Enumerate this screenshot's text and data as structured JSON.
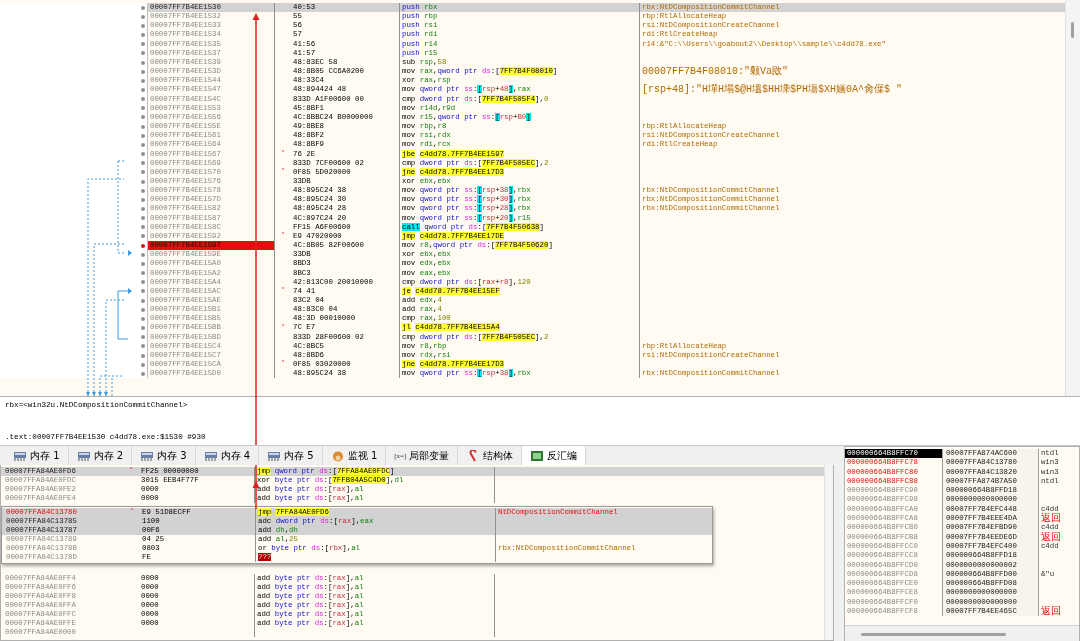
{
  "disassembly": {
    "rows": [
      {
        "address": "00007FF7B4EE1530",
        "bytes": "40:53",
        "mnemonic": "push",
        "operands": "rbx",
        "comment": "rbx:NtDCompositionCommitChannel",
        "kind": "stack",
        "selected": true,
        "breakpoint": false
      },
      {
        "address": "00007FF7B4EE1532",
        "bytes": "55",
        "mnemonic": "push",
        "operands": "rbp",
        "comment": "rbp:RtlAllocateHeap",
        "kind": "stack",
        "selected": false,
        "breakpoint": false
      },
      {
        "address": "00007FF7B4EE1533",
        "bytes": "56",
        "mnemonic": "push",
        "operands": "rsi",
        "comment": "rsi:NtDCompositionCreateChannel",
        "kind": "stack",
        "selected": false,
        "breakpoint": false
      },
      {
        "address": "00007FF7B4EE1534",
        "bytes": "57",
        "mnemonic": "push",
        "operands": "rdi",
        "comment": "rdi:RtlCreateHeap",
        "kind": "stack",
        "selected": false,
        "breakpoint": false
      },
      {
        "address": "00007FF7B4EE1535",
        "bytes": "41:56",
        "mnemonic": "push",
        "operands": "r14",
        "comment": "r14:&\"C:\\\\Users\\\\goabout2\\\\Desktop\\\\sample\\\\c4dd78.exe\"",
        "kind": "stack",
        "selected": false,
        "breakpoint": false
      },
      {
        "address": "00007FF7B4EE1537",
        "bytes": "41:57",
        "mnemonic": "push",
        "operands": "r15",
        "kind": "stack",
        "selected": false,
        "breakpoint": false
      },
      {
        "address": "00007FF7B4EE1539",
        "bytes": "48:83EC 58",
        "mnemonic": "sub",
        "operands": "rsp,58",
        "kind": "plain",
        "selected": false,
        "breakpoint": false
      },
      {
        "address": "00007FF7B4EE153D",
        "bytes": "48:8B05 CC6A0200",
        "mnemonic": "mov",
        "operands": "rax,qword ptr ds:[7FF7B4F08010]",
        "comment": "00007FF7B4F08010:\"颡Va敃\"",
        "kind": "plain",
        "selected": false,
        "breakpoint": false
      },
      {
        "address": "00007FF7B4EE1544",
        "bytes": "48:33C4",
        "mnemonic": "xor",
        "operands": "rax,rsp",
        "kind": "plain",
        "selected": false,
        "breakpoint": false
      },
      {
        "address": "00007FF7B4EE1547",
        "bytes": "48:894424 48",
        "mnemonic": "mov",
        "operands": "qword ptr ss:[rsp+48],rax",
        "comment": "[rsp+48]:\"H墠H塌$@H塭$HH塖$PH塲$XH婳0A^肏僷$ \"",
        "kind": "plain",
        "selected": false,
        "breakpoint": false
      },
      {
        "address": "00007FF7B4EE154C",
        "bytes": "833D A1F00600 00",
        "mnemonic": "cmp",
        "operands": "dword ptr ds:[7FF7B4F505F4],0",
        "kind": "plain",
        "selected": false,
        "breakpoint": false
      },
      {
        "address": "00007FF7B4EE1553",
        "bytes": "45:8BF1",
        "mnemonic": "mov",
        "operands": "r14d,r9d",
        "kind": "plain",
        "selected": false,
        "breakpoint": false
      },
      {
        "address": "00007FF7B4EE1556",
        "bytes": "4C:8BBC24 B0000000",
        "mnemonic": "mov",
        "operands": "r15,qword ptr ss:[rsp+B0]",
        "kind": "plain",
        "selected": false,
        "breakpoint": false
      },
      {
        "address": "00007FF7B4EE155E",
        "bytes": "49:8BE8",
        "mnemonic": "mov",
        "operands": "rbp,r8",
        "comment": "rbp:RtlAllocateHeap",
        "kind": "plain",
        "selected": false,
        "breakpoint": false
      },
      {
        "address": "00007FF7B4EE1561",
        "bytes": "48:8BF2",
        "mnemonic": "mov",
        "operands": "rsi,rdx",
        "comment": "rsi:NtDCompositionCreateChannel",
        "kind": "plain",
        "selected": false,
        "breakpoint": false
      },
      {
        "address": "00007FF7B4EE1564",
        "bytes": "48:8BF9",
        "mnemonic": "mov",
        "operands": "rdi,rcx",
        "comment": "rdi:RtlCreateHeap",
        "kind": "plain",
        "selected": false,
        "breakpoint": false
      },
      {
        "address": "00007FF7B4EE1567",
        "bytes": "76 2E",
        "mnemonic": "jbe",
        "operands": "c4dd78.7FF7B4EE1597",
        "kind": "jump",
        "branch": "˅",
        "selected": false,
        "breakpoint": false
      },
      {
        "address": "00007FF7B4EE1569",
        "bytes": "833D 7CF00600 02",
        "mnemonic": "cmp",
        "operands": "dword ptr ds:[7FF7B4F505EC],2",
        "kind": "plain",
        "selected": false,
        "breakpoint": false
      },
      {
        "address": "00007FF7B4EE1570",
        "bytes": "0F85 5D020000",
        "mnemonic": "jne",
        "operands": "c4dd78.7FF7B4EE17D3",
        "kind": "jump",
        "branch": "˅",
        "selected": false,
        "breakpoint": false
      },
      {
        "address": "00007FF7B4EE1576",
        "bytes": "33DB",
        "mnemonic": "xor",
        "operands": "ebx,ebx",
        "kind": "plain",
        "selected": false,
        "breakpoint": false
      },
      {
        "address": "00007FF7B4EE1578",
        "bytes": "48:895C24 38",
        "mnemonic": "mov",
        "operands": "qword ptr ss:[rsp+38],rbx",
        "comment": "rbx:NtDCompositionCommitChannel",
        "kind": "plain",
        "selected": false,
        "breakpoint": false
      },
      {
        "address": "00007FF7B4EE157D",
        "bytes": "48:895C24 30",
        "mnemonic": "mov",
        "operands": "qword ptr ss:[rsp+30],rbx",
        "comment": "rbx:NtDCompositionCommitChannel",
        "kind": "plain",
        "selected": false,
        "breakpoint": false
      },
      {
        "address": "00007FF7B4EE1582",
        "bytes": "48:895C24 28",
        "mnemonic": "mov",
        "operands": "qword ptr ss:[rsp+28],rbx",
        "comment": "rbx:NtDCompositionCommitChannel",
        "kind": "plain",
        "selected": false,
        "breakpoint": false
      },
      {
        "address": "00007FF7B4EE1587",
        "bytes": "4C:897C24 20",
        "mnemonic": "mov",
        "operands": "qword ptr ss:[rsp+20],r15",
        "kind": "plain",
        "selected": false,
        "breakpoint": false
      },
      {
        "address": "00007FF7B4EE158C",
        "bytes": "FF15 A6F00600",
        "mnemonic": "call",
        "operands": "qword ptr ds:[7FF7B4F50638]",
        "kind": "call",
        "selected": false,
        "breakpoint": false
      },
      {
        "address": "00007FF7B4EE1592",
        "bytes": "E9 47020000",
        "mnemonic": "jmp",
        "operands": "c4dd78.7FF7B4EE17DE",
        "kind": "jump",
        "branch": "˅",
        "selected": false,
        "breakpoint": false
      },
      {
        "address": "00007FF7B4EE1597",
        "bytes": "4C:8B05 82F00600",
        "mnemonic": "mov",
        "operands": "r8,qword ptr ds:[7FF7B4F50620]",
        "kind": "plain",
        "selected": false,
        "breakpoint": true
      },
      {
        "address": "00007FF7B4EE159E",
        "bytes": "33DB",
        "mnemonic": "xor",
        "operands": "ebx,ebx",
        "kind": "plain",
        "selected": false,
        "breakpoint": false
      },
      {
        "address": "00007FF7B4EE15A0",
        "bytes": "8BD3",
        "mnemonic": "mov",
        "operands": "edx,ebx",
        "kind": "plain",
        "selected": false,
        "breakpoint": false
      },
      {
        "address": "00007FF7B4EE15A2",
        "bytes": "8BC3",
        "mnemonic": "mov",
        "operands": "eax,ebx",
        "kind": "plain",
        "selected": false,
        "breakpoint": false
      },
      {
        "address": "00007FF7B4EE15A4",
        "bytes": "42:813C00 20010000",
        "mnemonic": "cmp",
        "operands": "dword ptr ds:[rax+r8],120",
        "kind": "plain",
        "selected": false,
        "breakpoint": false
      },
      {
        "address": "00007FF7B4EE15AC",
        "bytes": "74 41",
        "mnemonic": "je",
        "operands": "c4dd78.7FF7B4EE15EF",
        "kind": "jump",
        "branch": "˅",
        "selected": false,
        "breakpoint": false
      },
      {
        "address": "00007FF7B4EE15AE",
        "bytes": "83C2 04",
        "mnemonic": "add",
        "operands": "edx,4",
        "kind": "plain",
        "selected": false,
        "breakpoint": false
      },
      {
        "address": "00007FF7B4EE15B1",
        "bytes": "48:83C0 04",
        "mnemonic": "add",
        "operands": "rax,4",
        "kind": "plain",
        "selected": false,
        "breakpoint": false
      },
      {
        "address": "00007FF7B4EE15B5",
        "bytes": "48:3D 00010000",
        "mnemonic": "cmp",
        "operands": "rax,100",
        "kind": "plain",
        "selected": false,
        "breakpoint": false
      },
      {
        "address": "00007FF7B4EE15BB",
        "bytes": "7C E7",
        "mnemonic": "jl",
        "operands": "c4dd78.7FF7B4EE15A4",
        "kind": "jump",
        "branch": "˄",
        "selected": false,
        "breakpoint": false
      },
      {
        "address": "00007FF7B4EE15BD",
        "bytes": "833D 28F00600 02",
        "mnemonic": "cmp",
        "operands": "dword ptr ds:[7FF7B4F505EC],2",
        "kind": "plain",
        "selected": false,
        "breakpoint": false
      },
      {
        "address": "00007FF7B4EE15C4",
        "bytes": "4C:8BC5",
        "mnemonic": "mov",
        "operands": "r8,rbp",
        "comment": "rbp:RtlAllocateHeap",
        "kind": "plain",
        "selected": false,
        "breakpoint": false
      },
      {
        "address": "00007FF7B4EE15C7",
        "bytes": "48:8BD6",
        "mnemonic": "mov",
        "operands": "rdx,rsi",
        "comment": "rsi:NtDCompositionCreateChannel",
        "kind": "plain",
        "selected": false,
        "breakpoint": false
      },
      {
        "address": "00007FF7B4EE15CA",
        "bytes": "0F85 03020000",
        "mnemonic": "jne",
        "operands": "c4dd78.7FF7B4EE17D3",
        "kind": "jump",
        "branch": "˅",
        "selected": false,
        "breakpoint": false
      },
      {
        "address": "00007FF7B4EE15D0",
        "bytes": "48:895C24 38",
        "mnemonic": "mov",
        "operands": "qword ptr ss:[rsp+38],rbx",
        "comment": "rbx:NtDCompositionCommitChannel",
        "kind": "plain",
        "selected": false,
        "breakpoint": false
      }
    ]
  },
  "info": {
    "lines": [
      "rbx=<win32u.NtDCompositionCommitChannel>",
      ".text:00007FF7B4EE1530 c4dd78.exe:$1530 #930"
    ]
  },
  "tabs": [
    {
      "label": "内存 1",
      "kind": "memory",
      "selected": false
    },
    {
      "label": "内存 2",
      "kind": "memory",
      "selected": false
    },
    {
      "label": "内存 3",
      "kind": "memory",
      "selected": false
    },
    {
      "label": "内存 4",
      "kind": "memory",
      "selected": false
    },
    {
      "label": "内存 5",
      "kind": "memory",
      "selected": false
    },
    {
      "label": "监视 1",
      "kind": "watch",
      "selected": false
    },
    {
      "label": "局部变量",
      "kind": "text",
      "icon_text": "[x=]",
      "selected": false
    },
    {
      "label": "结构体",
      "kind": "struct",
      "selected": false
    },
    {
      "label": "反汇编",
      "kind": "chip",
      "selected": true
    }
  ],
  "memory_view": {
    "rows_above": [
      {
        "address": "00007FFA84AE0FD6",
        "bytes": "FF25 00000000",
        "mnemonic": "jmp",
        "operands": "qword ptr ds:[7FFA84AE0FDC]",
        "kind": "jump",
        "branch": "˄",
        "selected": true,
        "highlighted": false
      },
      {
        "address": "00007FFA84AE0FDC",
        "bytes": "3015 EEB4F77F",
        "mnemonic": "xor",
        "operands": "byte ptr ds:[7FFB04A5C4D0],dl",
        "kind": "plain",
        "selected": false,
        "highlighted": false
      },
      {
        "address": "00007FFA84AE0FE2",
        "bytes": "0000",
        "mnemonic": "add",
        "operands": "byte ptr ds:[rax],al",
        "kind": "plain",
        "selected": false,
        "highlighted": false
      },
      {
        "address": "00007FFA84AE0FE4",
        "bytes": "0000",
        "mnemonic": "add",
        "operands": "byte ptr ds:[rax],al",
        "kind": "plain",
        "selected": false,
        "highlighted": false
      }
    ],
    "popup": {
      "rows": [
        {
          "address": "00007FFA84C13780",
          "bytes": "E9 51D8ECFF",
          "mnemonic": "jmp",
          "operands": "7FFA84AE0FD6",
          "comment": "NtDCompositionCommitChannel",
          "kind": "jump",
          "branch": "˄",
          "selected": true,
          "highlighted": true
        },
        {
          "address": "00007FFA84C13785",
          "bytes": "1100",
          "mnemonic": "adc",
          "operands": "dword ptr ds:[rax],eax",
          "kind": "plain",
          "selected": true,
          "highlighted": false
        },
        {
          "address": "00007FFA84C13787",
          "bytes": "00F6",
          "mnemonic": "add",
          "operands": "dh,dh",
          "kind": "plain",
          "selected": true,
          "highlighted": false
        },
        {
          "address": "00007FFA84C13789",
          "bytes": "04 25",
          "mnemonic": "add",
          "operands": "al,25",
          "kind": "plain",
          "selected": false,
          "highlighted": false
        },
        {
          "address": "00007FFA84C1378B",
          "bytes": "0803",
          "mnemonic": "or",
          "operands": "byte ptr ds:[rbx],al",
          "comment": "rbx:NtDCompositionCommitChannel",
          "kind": "plain",
          "selected": false,
          "highlighted": false
        },
        {
          "address": "00007FFA84C1378D",
          "bytes": "FE",
          "mnemonic": "???",
          "kind": "invalid",
          "selected": false,
          "highlighted": false
        }
      ]
    },
    "rows_below": [
      {
        "address": "00007FFA84AE0FF4",
        "bytes": "0000",
        "mnemonic": "add",
        "operands": "byte ptr ds:[rax],al",
        "kind": "plain",
        "selected": false,
        "highlighted": false
      },
      {
        "address": "00007FFA84AE0FF6",
        "bytes": "0000",
        "mnemonic": "add",
        "operands": "byte ptr ds:[rax],al",
        "kind": "plain",
        "selected": false,
        "highlighted": false
      },
      {
        "address": "00007FFA84AE0FF8",
        "bytes": "0000",
        "mnemonic": "add",
        "operands": "byte ptr ds:[rax],al",
        "kind": "plain",
        "selected": false,
        "highlighted": false
      },
      {
        "address": "00007FFA84AE0FFA",
        "bytes": "0000",
        "mnemonic": "add",
        "operands": "byte ptr ds:[rax],al",
        "kind": "plain",
        "selected": false,
        "highlighted": false
      },
      {
        "address": "00007FFA84AE0FFC",
        "bytes": "0000",
        "mnemonic": "add",
        "operands": "byte ptr ds:[rax],al",
        "kind": "plain",
        "selected": false,
        "highlighted": false
      },
      {
        "address": "00007FFA84AE0FFE",
        "bytes": "0000",
        "mnemonic": "add",
        "operands": "byte ptr ds:[rax],al",
        "kind": "plain",
        "selected": false,
        "highlighted": false
      },
      {
        "address": "00007FFA84AE0000",
        "selected": false,
        "highlighted": false
      }
    ]
  },
  "stack": {
    "rows": [
      {
        "address": "000000664B8FFC70",
        "value": "00007FFA874AC600",
        "comment": "ntdl",
        "kind": "plain",
        "selected": true,
        "highlighted": false
      },
      {
        "address": "000000664B8FFC78",
        "value": "00007FFA84C13780",
        "comment": "win3",
        "kind": "plain",
        "selected": false,
        "highlighted": true
      },
      {
        "address": "000000664B8FFC80",
        "value": "00007FFA84C13820",
        "comment": "win3",
        "kind": "plain",
        "selected": false,
        "highlighted": true
      },
      {
        "address": "000000664B8FFC88",
        "value": "00007FFA874B7A50",
        "comment": "ntdl",
        "kind": "plain",
        "selected": false,
        "highlighted": true
      },
      {
        "address": "000000664B8FFC90",
        "value": "000000664B8FFD18",
        "kind": "plain",
        "selected": false,
        "highlighted": false
      },
      {
        "address": "000000664B8FFC98",
        "value": "0000000000000000",
        "kind": "plain",
        "selected": false,
        "highlighted": false
      },
      {
        "address": "000000664B8FFCA0",
        "value": "00007FF7B4EFC448",
        "comment": "c4dd",
        "kind": "plain",
        "selected": false,
        "highlighted": false
      },
      {
        "address": "000000664B8FFCA8",
        "value": "00007FF7B4EEE4DA",
        "comment": "返回",
        "kind": "return",
        "selected": false,
        "highlighted": false
      },
      {
        "address": "000000664B8FFCB0",
        "value": "00007FF7B4EFBD90",
        "comment": "c4dd",
        "kind": "plain",
        "selected": false,
        "highlighted": false
      },
      {
        "address": "000000664B8FFCB8",
        "value": "00007FF7B4EEDE6D",
        "comment": "返回",
        "kind": "return",
        "selected": false,
        "highlighted": false
      },
      {
        "address": "000000664B8FFCC0",
        "value": "00007FF7B4EFC400",
        "comment": "c4dd",
        "kind": "plain",
        "selected": false,
        "highlighted": false
      },
      {
        "address": "000000664B8FFCC8",
        "value": "000000664B8FFD18",
        "kind": "plain",
        "selected": false,
        "highlighted": false
      },
      {
        "address": "000000664B8FFCD0",
        "value": "0000000000000002",
        "kind": "plain",
        "selected": false,
        "highlighted": false
      },
      {
        "address": "000000664B8FFCD8",
        "value": "000000664B8FFD00",
        "comment": "&\"u",
        "kind": "plain",
        "selected": false,
        "highlighted": false
      },
      {
        "address": "000000664B8FFCE0",
        "value": "000000664B8FFD08",
        "kind": "plain",
        "selected": false,
        "highlighted": false
      },
      {
        "address": "000000664B8FFCE8",
        "value": "0000000000000000",
        "kind": "plain",
        "selected": false,
        "highlighted": false
      },
      {
        "address": "000000664B8FFCF0",
        "value": "0000000000000000",
        "kind": "plain",
        "selected": false,
        "highlighted": false
      },
      {
        "address": "000000664B8FFCF8",
        "value": "00007FF7B4EE465C",
        "comment": "返回",
        "kind": "return",
        "selected": false,
        "highlighted": false
      }
    ]
  }
}
